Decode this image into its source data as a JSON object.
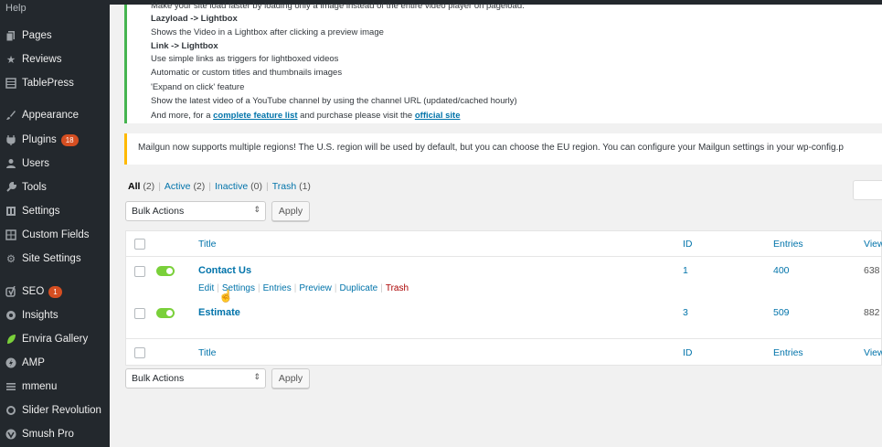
{
  "sidebar": {
    "top_label": "Help",
    "items": [
      {
        "label": "Pages",
        "icon": "pages-icon"
      },
      {
        "label": "Reviews",
        "icon": "star-icon"
      },
      {
        "label": "TablePress",
        "icon": "table-icon"
      },
      {
        "label": "Appearance",
        "icon": "brush-icon"
      },
      {
        "label": "Plugins",
        "icon": "plugin-icon",
        "badge": "18"
      },
      {
        "label": "Users",
        "icon": "users-icon"
      },
      {
        "label": "Tools",
        "icon": "wrench-icon"
      },
      {
        "label": "Settings",
        "icon": "settings-icon"
      },
      {
        "label": "Custom Fields",
        "icon": "grid-icon"
      },
      {
        "label": "Site Settings",
        "icon": "gear-icon"
      },
      {
        "label": "SEO",
        "icon": "yoast-icon",
        "badge": "1"
      },
      {
        "label": "Insights",
        "icon": "insights-icon"
      },
      {
        "label": "Envira Gallery",
        "icon": "leaf-icon"
      },
      {
        "label": "AMP",
        "icon": "amp-icon"
      },
      {
        "label": "mmenu",
        "icon": "menu-icon"
      },
      {
        "label": "Slider Revolution",
        "icon": "refresh-icon"
      },
      {
        "label": "Smush Pro",
        "icon": "smush-icon"
      }
    ]
  },
  "info": {
    "line0": "Make your site load faster by loading only a image instead of the entire video player on pageload.",
    "line1": "Lazyload -> Lightbox",
    "line2": "Shows the Video in a Lightbox after clicking a preview image",
    "line3": "Link -> Lightbox",
    "line4": "Use simple links as triggers for lightboxed videos",
    "line5": "Automatic or custom titles and thumbnails images",
    "line6": "'Expand on click' feature",
    "line7": "Show the latest video of a YouTube channel by using the channel URL (updated/cached hourly)",
    "line8_prefix": "And more, for a ",
    "line8_link1": "complete feature list",
    "line8_mid": " and purchase please visit the ",
    "line8_link2": "official site"
  },
  "notice": "Mailgun now supports multiple regions! The U.S. region will be used by default, but you can choose the EU region. You can configure your Mailgun settings in your wp-config.p",
  "filters": {
    "all": "All",
    "all_count": "(2)",
    "active": "Active",
    "active_count": "(2)",
    "inactive": "Inactive",
    "inactive_count": "(0)",
    "trash": "Trash",
    "trash_count": "(1)",
    "sep": "|"
  },
  "bulk_actions": "Bulk Actions",
  "apply": "Apply",
  "table": {
    "columns": {
      "title": "Title",
      "id": "ID",
      "entries": "Entries",
      "views": "View"
    },
    "rows": [
      {
        "title": "Contact Us",
        "id": "1",
        "entries": "400",
        "views": "638"
      },
      {
        "title": "Estimate",
        "id": "3",
        "entries": "509",
        "views": "882"
      }
    ],
    "row_actions": {
      "edit": "Edit",
      "settings": "Settings",
      "entries": "Entries",
      "preview": "Preview",
      "duplicate": "Duplicate",
      "trash": "Trash",
      "sep": "|"
    }
  },
  "colors": {
    "accent": "#0073aa",
    "sidebar_bg": "#23282d",
    "success": "#46b450",
    "warning": "#ffb900",
    "toggle_on": "#7ad03a",
    "trash": "#a00"
  }
}
